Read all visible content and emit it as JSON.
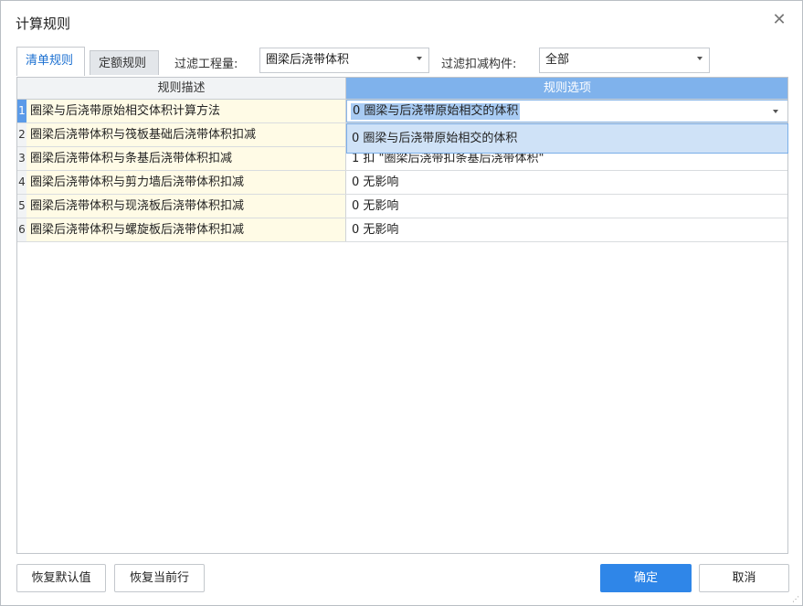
{
  "dialog": {
    "title": "计算规则"
  },
  "tabs": [
    {
      "label": "清单规则"
    },
    {
      "label": "定额规则"
    }
  ],
  "filters": {
    "quantity_label": "过滤工程量:",
    "quantity_value": "圈梁后浇带体积",
    "component_label": "过滤扣减构件:",
    "component_value": "全部"
  },
  "grid": {
    "headers": {
      "description": "规则描述",
      "option": "规则选项"
    },
    "rows": [
      {
        "num": "1",
        "description": "圈梁与后浇带原始相交体积计算方法",
        "option": "0 圈梁与后浇带原始相交的体积"
      },
      {
        "num": "2",
        "description": "圈梁后浇带体积与筏板基础后浇带体积扣减",
        "option": ""
      },
      {
        "num": "3",
        "description": "圈梁后浇带体积与条基后浇带体积扣减",
        "option": "1 扣 \"圈梁后浇带扣条基后浇带体积\""
      },
      {
        "num": "4",
        "description": "圈梁后浇带体积与剪力墙后浇带体积扣减",
        "option": "0 无影响"
      },
      {
        "num": "5",
        "description": "圈梁后浇带体积与现浇板后浇带体积扣减",
        "option": "0 无影响"
      },
      {
        "num": "6",
        "description": "圈梁后浇带体积与螺旋板后浇带体积扣减",
        "option": "0 无影响"
      }
    ],
    "dropdown_option": "0 圈梁与后浇带原始相交的体积"
  },
  "buttons": {
    "restore_default": "恢复默认值",
    "restore_row": "恢复当前行",
    "ok": "确定",
    "cancel": "取消"
  },
  "colors": {
    "accent": "#2f86e8",
    "header_selected": "#7fb2ec",
    "desc_bg": "#fffbe6"
  }
}
